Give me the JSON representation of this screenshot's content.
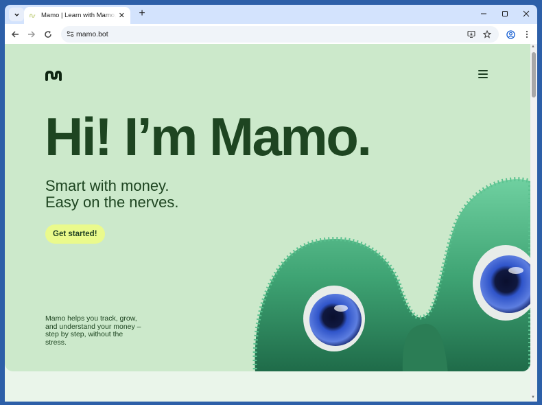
{
  "browser": {
    "tab_title": "Mamo | Learn with Mamo, Earn",
    "url": "mamo.bot"
  },
  "page": {
    "headline": "Hi! I’m Mamo.",
    "tagline_line1": "Smart with money.",
    "tagline_line2": "Easy on the nerves.",
    "cta_label": "Get started!",
    "description": "Mamo helps you track, grow, and understand your money – step by step, without the stress."
  },
  "colors": {
    "hero_bg": "#cce9cb",
    "text_dark_green": "#1e4521",
    "cta_bg": "#eafa8c"
  }
}
